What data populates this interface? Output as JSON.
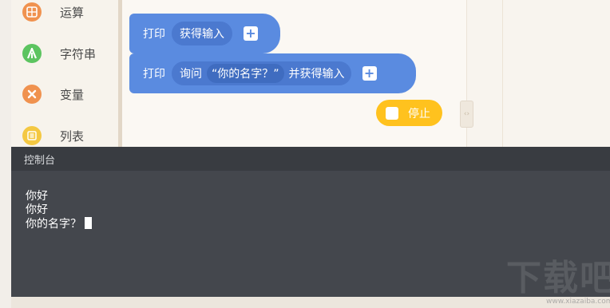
{
  "sidebar": {
    "categories": [
      {
        "label": "运算",
        "icon": "calculator-icon",
        "color": "#f0924f"
      },
      {
        "label": "字符串",
        "icon": "letter-a-icon",
        "color": "#5cc460"
      },
      {
        "label": "变量",
        "icon": "x-variable-icon",
        "color": "#f0924f"
      },
      {
        "label": "列表",
        "icon": "list-icon",
        "color": "#f4c842"
      }
    ]
  },
  "blocks": {
    "block1": {
      "keyword": "打印",
      "slot": "获得输入"
    },
    "block2": {
      "keyword": "打印",
      "ask": "询问",
      "string": "“你的名字？”",
      "suffix": "并获得输入"
    }
  },
  "stop_button": {
    "label": "停止",
    "color": "#ffc21e"
  },
  "console": {
    "title": "控制台",
    "lines": [
      "你好",
      "你好",
      "你的名字？"
    ]
  },
  "watermark": {
    "text": "下载吧",
    "sub": "www.xiazaiba.com"
  },
  "colors": {
    "block": "#5a8be0",
    "console_bg": "#44474d",
    "console_header": "#393c41"
  }
}
